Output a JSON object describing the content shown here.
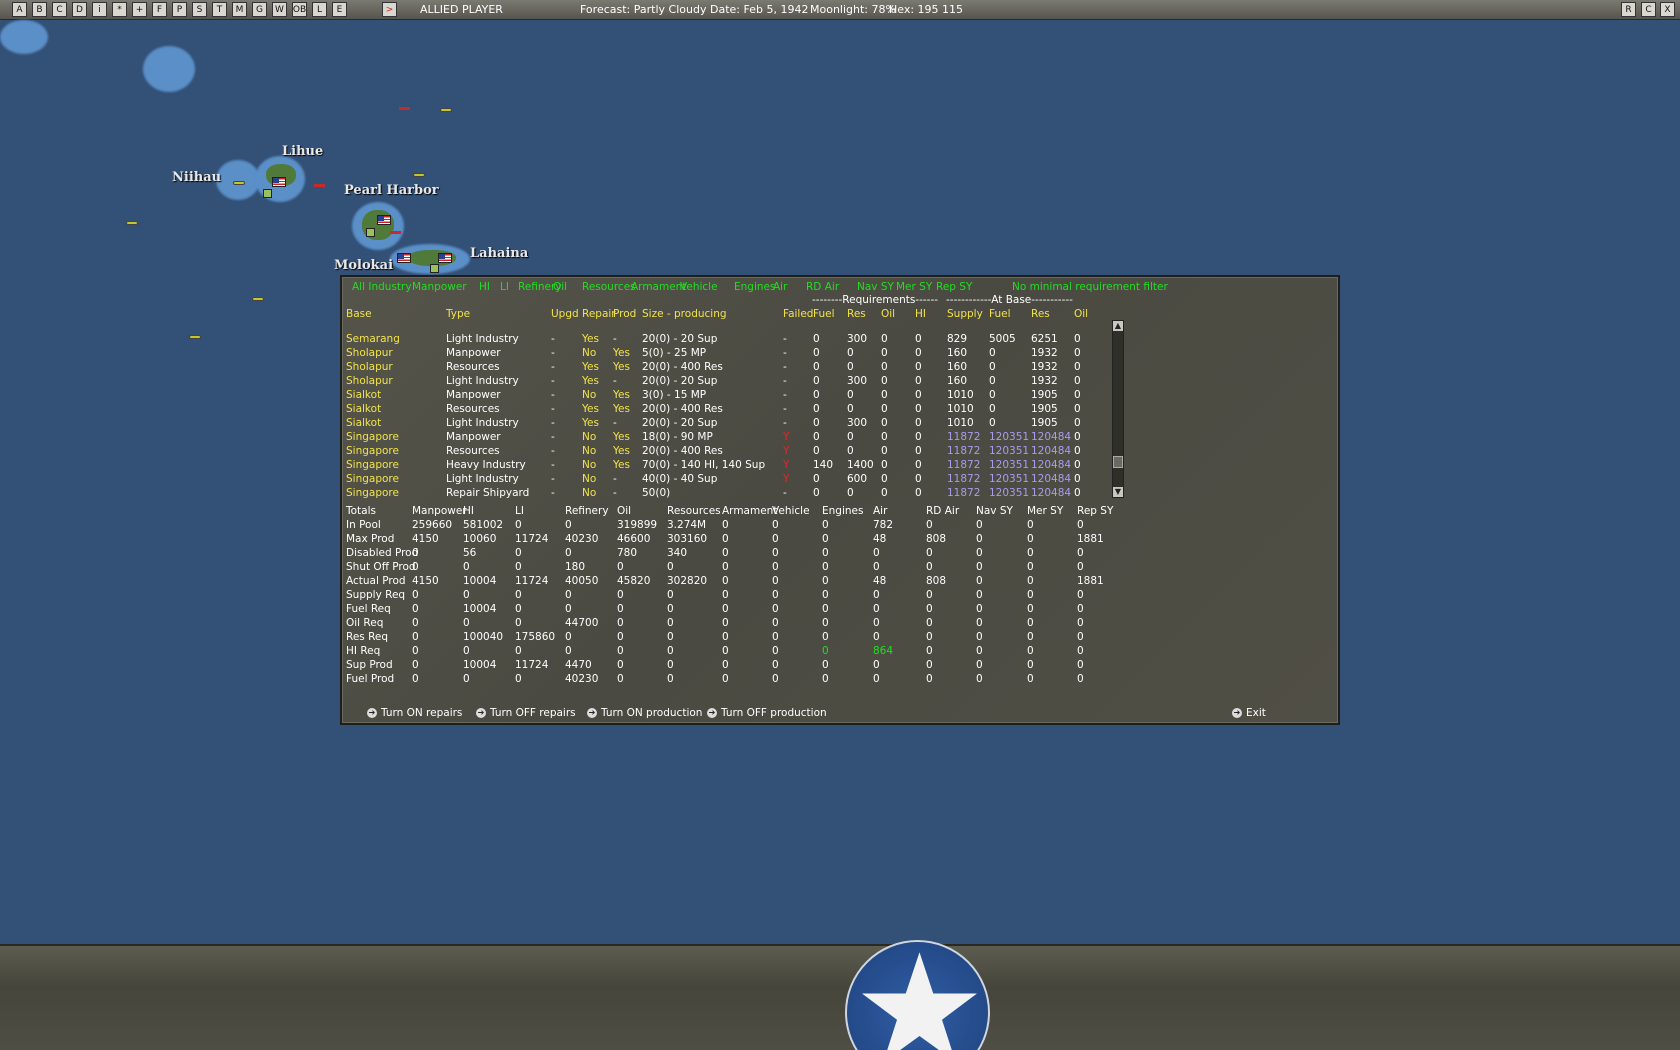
{
  "topbar": {
    "icons": [
      "A",
      "B",
      "C",
      "D",
      "i",
      "*",
      "+",
      "F",
      "P",
      "S",
      "T",
      "M",
      "G",
      "W",
      "OB",
      "L",
      "E",
      ">"
    ],
    "player": "ALLIED PLAYER",
    "forecast": "Forecast: Partly Cloudy",
    "date": "Date: Feb 5, 1942",
    "moonlight": "Moonlight: 78%",
    "hex": "Hex: 195 115",
    "right_icons": [
      "R",
      "C",
      "X"
    ]
  },
  "map": {
    "places": [
      "Niihau",
      "Lihue",
      "Pearl Harbor",
      "Lahaina",
      "Molokai"
    ]
  },
  "filters": [
    "All Industry",
    "Manpower",
    "HI",
    "LI",
    "Refinery",
    "Oil",
    "Resources",
    "Armament",
    "Vehicle",
    "Engines",
    "Air",
    "RD Air",
    "Nav SY",
    "Mer SY",
    "Rep SY",
    "No minimal requirement filter"
  ],
  "groups": {
    "requirements": "--------Requirements------",
    "at_base": "------------At Base-----------"
  },
  "columns": [
    "Base",
    "Type",
    "Upgd",
    "Repair",
    "Prod",
    "Size - producing",
    "Failed",
    "Fuel",
    "Res",
    "Oil",
    "HI",
    "Supply",
    "Fuel",
    "Res",
    "Oil"
  ],
  "rows": [
    {
      "base": "Semarang",
      "type": "Light Industry",
      "upgd": "-",
      "repair": "Yes",
      "prod": "-",
      "size": "20(0) - 20 Sup",
      "failed": "-",
      "fuel": "0",
      "res": "300",
      "oil": "0",
      "hi": "0",
      "supply": "829",
      "bfuel": "5005",
      "bres": "6251",
      "boil": "0",
      "hl": false
    },
    {
      "base": "Sholapur",
      "type": "Manpower",
      "upgd": "-",
      "repair": "No",
      "prod": "Yes",
      "size": "5(0) - 25 MP",
      "failed": "-",
      "fuel": "0",
      "res": "0",
      "oil": "0",
      "hi": "0",
      "supply": "160",
      "bfuel": "0",
      "bres": "1932",
      "boil": "0",
      "hl": false
    },
    {
      "base": "Sholapur",
      "type": "Resources",
      "upgd": "-",
      "repair": "Yes",
      "prod": "Yes",
      "size": "20(0) - 400 Res",
      "failed": "-",
      "fuel": "0",
      "res": "0",
      "oil": "0",
      "hi": "0",
      "supply": "160",
      "bfuel": "0",
      "bres": "1932",
      "boil": "0",
      "hl": false
    },
    {
      "base": "Sholapur",
      "type": "Light Industry",
      "upgd": "-",
      "repair": "Yes",
      "prod": "-",
      "size": "20(0) - 20 Sup",
      "failed": "-",
      "fuel": "0",
      "res": "300",
      "oil": "0",
      "hi": "0",
      "supply": "160",
      "bfuel": "0",
      "bres": "1932",
      "boil": "0",
      "hl": false
    },
    {
      "base": "Sialkot",
      "type": "Manpower",
      "upgd": "-",
      "repair": "No",
      "prod": "Yes",
      "size": "3(0) - 15 MP",
      "failed": "-",
      "fuel": "0",
      "res": "0",
      "oil": "0",
      "hi": "0",
      "supply": "1010",
      "bfuel": "0",
      "bres": "1905",
      "boil": "0",
      "hl": false
    },
    {
      "base": "Sialkot",
      "type": "Resources",
      "upgd": "-",
      "repair": "Yes",
      "prod": "Yes",
      "size": "20(0) - 400 Res",
      "failed": "-",
      "fuel": "0",
      "res": "0",
      "oil": "0",
      "hi": "0",
      "supply": "1010",
      "bfuel": "0",
      "bres": "1905",
      "boil": "0",
      "hl": false
    },
    {
      "base": "Sialkot",
      "type": "Light Industry",
      "upgd": "-",
      "repair": "Yes",
      "prod": "-",
      "size": "20(0) - 20 Sup",
      "failed": "-",
      "fuel": "0",
      "res": "300",
      "oil": "0",
      "hi": "0",
      "supply": "1010",
      "bfuel": "0",
      "bres": "1905",
      "boil": "0",
      "hl": false
    },
    {
      "base": "Singapore",
      "type": "Manpower",
      "upgd": "-",
      "repair": "No",
      "prod": "Yes",
      "size": "18(0) - 90 MP",
      "failed": "Y",
      "fuel": "0",
      "res": "0",
      "oil": "0",
      "hi": "0",
      "supply": "11872",
      "bfuel": "120351",
      "bres": "120484",
      "boil": "0",
      "hl": true
    },
    {
      "base": "Singapore",
      "type": "Resources",
      "upgd": "-",
      "repair": "No",
      "prod": "Yes",
      "size": "20(0) - 400 Res",
      "failed": "Y",
      "fuel": "0",
      "res": "0",
      "oil": "0",
      "hi": "0",
      "supply": "11872",
      "bfuel": "120351",
      "bres": "120484",
      "boil": "0",
      "hl": true
    },
    {
      "base": "Singapore",
      "type": "Heavy Industry",
      "upgd": "-",
      "repair": "No",
      "prod": "Yes",
      "size": "70(0) - 140 HI, 140 Sup",
      "failed": "Y",
      "fuel": "140",
      "res": "1400",
      "oil": "0",
      "hi": "0",
      "supply": "11872",
      "bfuel": "120351",
      "bres": "120484",
      "boil": "0",
      "hl": true
    },
    {
      "base": "Singapore",
      "type": "Light Industry",
      "upgd": "-",
      "repair": "No",
      "prod": "-",
      "size": "40(0) - 40 Sup",
      "failed": "Y",
      "fuel": "0",
      "res": "600",
      "oil": "0",
      "hi": "0",
      "supply": "11872",
      "bfuel": "120351",
      "bres": "120484",
      "boil": "0",
      "hl": true
    },
    {
      "base": "Singapore",
      "type": "Repair Shipyard",
      "upgd": "-",
      "repair": "No",
      "prod": "-",
      "size": "50(0)",
      "failed": "-",
      "fuel": "0",
      "res": "0",
      "oil": "0",
      "hi": "0",
      "supply": "11872",
      "bfuel": "120351",
      "bres": "120484",
      "boil": "0",
      "hl": true
    }
  ],
  "totals_header": [
    "Totals",
    "Manpower",
    "HI",
    "LI",
    "Refinery",
    "Oil",
    "Resources",
    "Armament",
    "Vehicle",
    "Engines",
    "Air",
    "RD Air",
    "Nav SY",
    "Mer SY",
    "Rep SY"
  ],
  "totals": [
    [
      "In Pool",
      "259660",
      "581002",
      "0",
      "0",
      "319899",
      "3.274M",
      "0",
      "0",
      "0",
      "782",
      "0",
      "0",
      "0",
      "0"
    ],
    [
      "Max Prod",
      "4150",
      "10060",
      "11724",
      "40230",
      "46600",
      "303160",
      "0",
      "0",
      "0",
      "48",
      "808",
      "0",
      "0",
      "1881"
    ],
    [
      "Disabled Prod",
      "0",
      "56",
      "0",
      "0",
      "780",
      "340",
      "0",
      "0",
      "0",
      "0",
      "0",
      "0",
      "0",
      "0"
    ],
    [
      "Shut Off Prod",
      "0",
      "0",
      "0",
      "180",
      "0",
      "0",
      "0",
      "0",
      "0",
      "0",
      "0",
      "0",
      "0",
      "0"
    ],
    [
      "Actual Prod",
      "4150",
      "10004",
      "11724",
      "40050",
      "45820",
      "302820",
      "0",
      "0",
      "0",
      "48",
      "808",
      "0",
      "0",
      "1881"
    ],
    [
      "Supply Req",
      "0",
      "0",
      "0",
      "0",
      "0",
      "0",
      "0",
      "0",
      "0",
      "0",
      "0",
      "0",
      "0",
      "0"
    ],
    [
      "Fuel Req",
      "0",
      "10004",
      "0",
      "0",
      "0",
      "0",
      "0",
      "0",
      "0",
      "0",
      "0",
      "0",
      "0",
      "0"
    ],
    [
      "Oil Req",
      "0",
      "0",
      "0",
      "44700",
      "0",
      "0",
      "0",
      "0",
      "0",
      "0",
      "0",
      "0",
      "0",
      "0"
    ],
    [
      "Res Req",
      "0",
      "100040",
      "175860",
      "0",
      "0",
      "0",
      "0",
      "0",
      "0",
      "0",
      "0",
      "0",
      "0",
      "0"
    ],
    [
      "HI Req",
      "0",
      "0",
      "0",
      "0",
      "0",
      "0",
      "0",
      "0",
      "0",
      "864",
      "0",
      "0",
      "0",
      "0"
    ],
    [
      "Sup Prod",
      "0",
      "10004",
      "11724",
      "4470",
      "0",
      "0",
      "0",
      "0",
      "0",
      "0",
      "0",
      "0",
      "0",
      "0"
    ],
    [
      "Fuel Prod",
      "0",
      "0",
      "0",
      "40230",
      "0",
      "0",
      "0",
      "0",
      "0",
      "0",
      "0",
      "0",
      "0",
      "0"
    ]
  ],
  "actions": [
    "Turn ON repairs",
    "Turn OFF repairs",
    "Turn ON production",
    "Turn OFF production"
  ],
  "exit_label": "Exit",
  "colors": {
    "sea": "#335076",
    "filter_text": "#22dd22",
    "header_text": "#f2e34a",
    "failed": "#ee2222",
    "at_base_highlight": "#a79cf0"
  }
}
